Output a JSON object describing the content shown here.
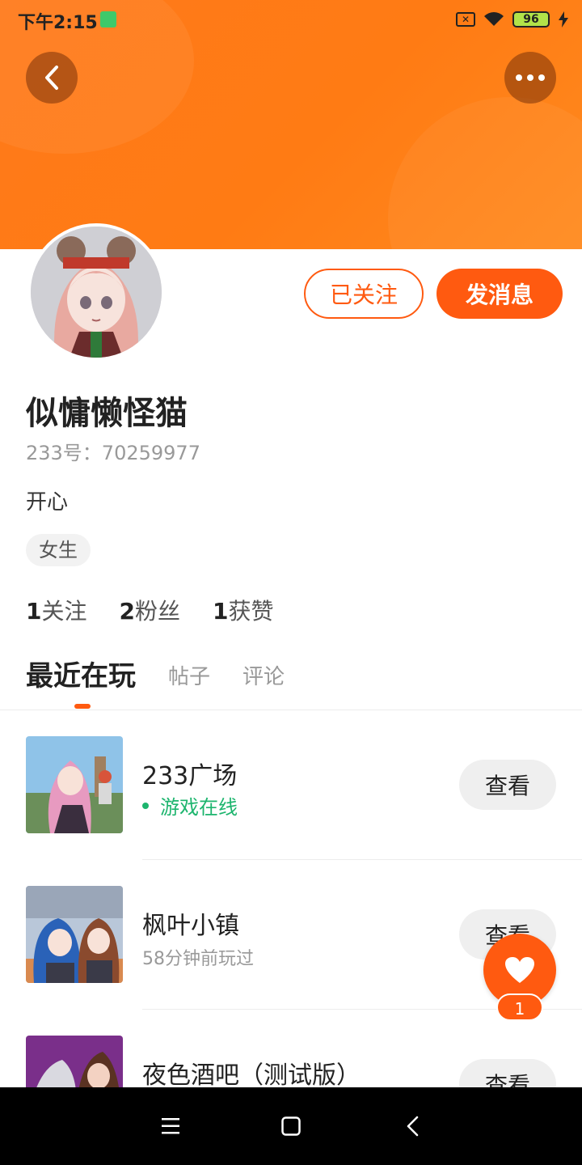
{
  "status_bar": {
    "time": "下午2:15",
    "battery": "96"
  },
  "profile": {
    "name": "似慵懒怪猫",
    "uid": "233号：70259977",
    "bio": "开心",
    "tag": "女生",
    "follow_label": "已关注",
    "message_label": "发消息"
  },
  "stats": [
    {
      "count": "1",
      "label": "关注"
    },
    {
      "count": "2",
      "label": "粉丝"
    },
    {
      "count": "1",
      "label": "获赞"
    }
  ],
  "tabs": {
    "active": "最近在玩",
    "posts": "帖子",
    "comments": "评论"
  },
  "games": [
    {
      "title": "233广场",
      "status": "游戏在线",
      "button": "查看"
    },
    {
      "title": "枫叶小镇",
      "status": "58分钟前玩过",
      "button": "查看"
    },
    {
      "title": "夜色酒吧（测试版）",
      "button": "查看"
    }
  ],
  "like_fab": {
    "count": "1"
  },
  "colors": {
    "accent": "#ff5a10",
    "banner": "#ff7b14",
    "online": "#1db56e"
  },
  "icons": [
    "back-icon",
    "more-icon",
    "heart-icon",
    "menu-icon",
    "home-icon",
    "nav-back-icon"
  ]
}
